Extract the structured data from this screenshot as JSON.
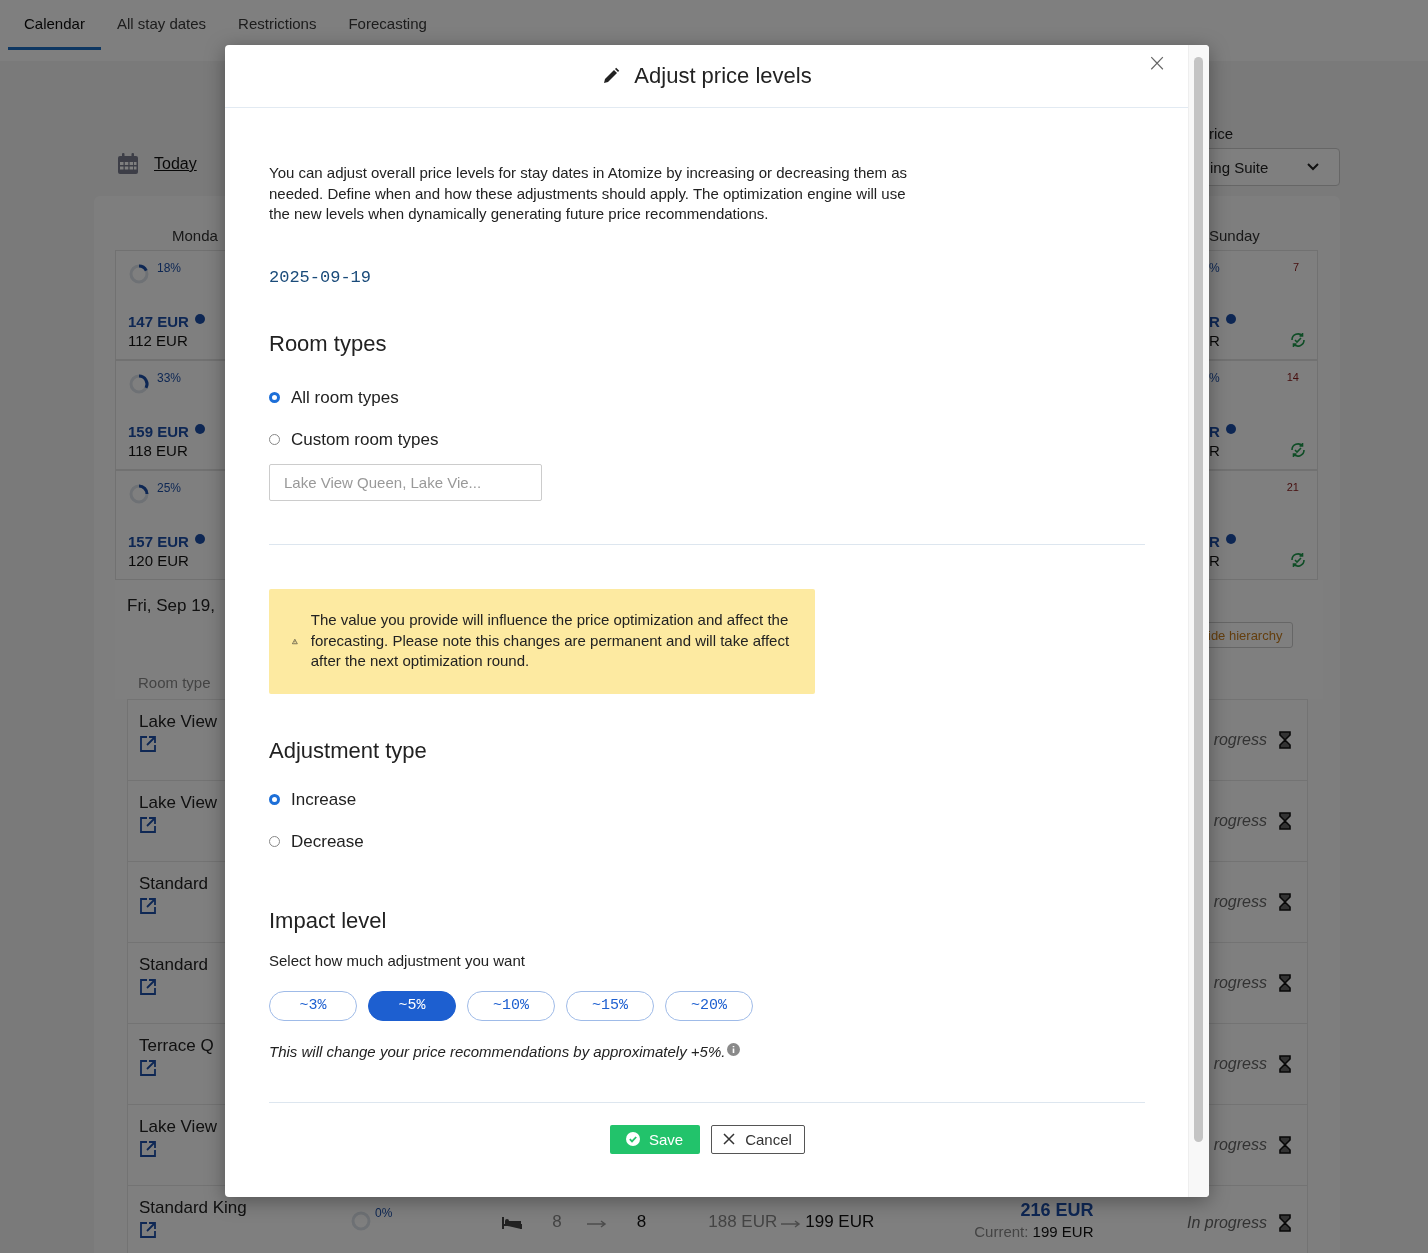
{
  "tabs": [
    {
      "label": "Calendar",
      "selected": true
    },
    {
      "label": "All stay dates",
      "selected": false
    },
    {
      "label": "Restrictions",
      "selected": false
    },
    {
      "label": "Forecasting",
      "selected": false
    }
  ],
  "toolbar": {
    "today_link": "Today",
    "price_label": "rice",
    "room_select": "ing Suite"
  },
  "calendar": {
    "day_headers": [
      "Monda",
      "Sunday"
    ],
    "weeks": [
      {
        "occupancy": "18%",
        "recommended": "147 EUR",
        "current": "112 EUR",
        "right_occupancy": "%",
        "right_count": "7",
        "right_recommended": "R",
        "right_current": "R"
      },
      {
        "occupancy": "33%",
        "recommended": "159 EUR",
        "current": "118 EUR",
        "right_occupancy": "%",
        "right_count": "14",
        "right_recommended": "R",
        "right_current": "R"
      },
      {
        "occupancy": "25%",
        "recommended": "157 EUR",
        "current": "120 EUR",
        "right_count": "21",
        "right_recommended": "R",
        "right_current": "R"
      }
    ]
  },
  "day_detail": {
    "date": "Fri, Sep 19,",
    "hierarchy_button": "ide hierarchy",
    "column_header": "Room type",
    "rooms": [
      {
        "name": "Lake View",
        "status": "rogress"
      },
      {
        "name": "Lake View",
        "status": "rogress"
      },
      {
        "name": "Standard",
        "status": "rogress"
      },
      {
        "name": "Standard",
        "status": "rogress"
      },
      {
        "name": "Terrace Q",
        "status": "rogress"
      },
      {
        "name": "Lake View",
        "status": "rogress"
      }
    ],
    "last_room": {
      "name": "Standard King",
      "occupancy": "0%",
      "rooms_from": "8",
      "rooms_to": "8",
      "price_from": "188 EUR",
      "price_to": "199 EUR",
      "recommended": "216 EUR",
      "current_label": "Current:",
      "current": "199 EUR",
      "status": "In progress"
    }
  },
  "modal": {
    "title": "Adjust price levels",
    "close": "×",
    "intro": "You can adjust overall price levels for stay dates in Atomize by increasing or decreasing them as needed. Define when and how these adjustments should apply. The optimization engine will use the new levels when dynamically generating future price recommendations.",
    "date": "2025-09-19",
    "room_types": {
      "heading": "Room types",
      "options": [
        {
          "label": "All room types",
          "selected": true
        },
        {
          "label": "Custom room types",
          "selected": false
        }
      ],
      "placeholder": "Lake View Queen, Lake Vie..."
    },
    "warning": "The value you provide will influence the price optimization and affect the forecasting. Please note this changes are permanent and will take affect after the next optimization round.",
    "adjustment_type": {
      "heading": "Adjustment type",
      "options": [
        {
          "label": "Increase",
          "selected": true
        },
        {
          "label": "Decrease",
          "selected": false
        }
      ]
    },
    "impact": {
      "heading": "Impact level",
      "hint": "Select how much adjustment you want",
      "options": [
        {
          "label": "~3%",
          "selected": false
        },
        {
          "label": "~5%",
          "selected": true
        },
        {
          "label": "~10%",
          "selected": false
        },
        {
          "label": "~15%",
          "selected": false
        },
        {
          "label": "~20%",
          "selected": false
        }
      ],
      "note": "This will change your price recommendations by approximately +5%."
    },
    "buttons": {
      "save": "Save",
      "cancel": "Cancel"
    }
  }
}
